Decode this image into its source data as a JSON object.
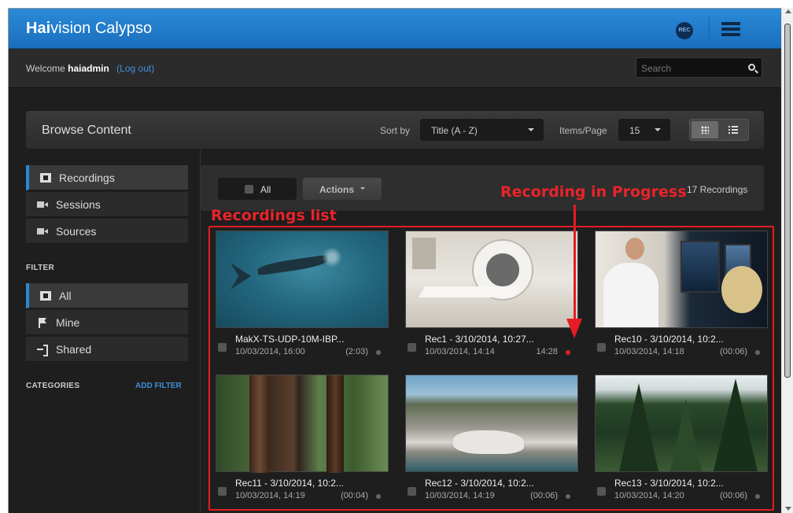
{
  "header": {
    "brand_bold": "Hai",
    "brand_rest": "vision Calypso",
    "rec_badge": "REC"
  },
  "welcome": {
    "prefix": "Welcome",
    "username": "haiadmin",
    "logout": "(Log out)"
  },
  "search": {
    "placeholder": "Search"
  },
  "browse": {
    "title": "Browse Content",
    "sort_label": "Sort by",
    "sort_value": "Title (A - Z)",
    "ipp_label": "Items/Page",
    "ipp_value": "15"
  },
  "sidebar": {
    "items": [
      {
        "label": "Recordings",
        "icon": "film-icon",
        "active": true
      },
      {
        "label": "Sessions",
        "icon": "camera-icon",
        "active": false
      },
      {
        "label": "Sources",
        "icon": "camera-icon",
        "active": false
      }
    ],
    "filter_heading": "FILTER",
    "filters": [
      {
        "label": "All",
        "icon": "film-icon",
        "active": true
      },
      {
        "label": "Mine",
        "icon": "flag-icon",
        "active": false
      },
      {
        "label": "Shared",
        "icon": "share-icon",
        "active": false
      }
    ],
    "categories_heading": "CATEGORIES",
    "add_filter": "ADD FILTER"
  },
  "content": {
    "all_label": "All",
    "actions_label": "Actions",
    "count_text": "17 Recordings"
  },
  "recordings": [
    {
      "title": "MakX-TS-UDP-10M-IBP...",
      "date": "10/03/2014, 16:00",
      "duration": "(2:03)",
      "live": false
    },
    {
      "title": "Rec1 - 3/10/2014, 10:27...",
      "date": "10/03/2014, 14:14",
      "duration": "14:28",
      "live": true
    },
    {
      "title": "Rec10 - 3/10/2014, 10:2...",
      "date": "10/03/2014, 14:18",
      "duration": "(00:06)",
      "live": false
    },
    {
      "title": "Rec11 - 3/10/2014, 10:2...",
      "date": "10/03/2014, 14:19",
      "duration": "(00:04)",
      "live": false
    },
    {
      "title": "Rec12 - 3/10/2014, 10:2...",
      "date": "10/03/2014, 14:19",
      "duration": "(00:06)",
      "live": false
    },
    {
      "title": "Rec13 - 3/10/2014, 10:2...",
      "date": "10/03/2014, 14:20",
      "duration": "(00:06)",
      "live": false
    }
  ],
  "annotations": {
    "list_label": "Recordings list",
    "progress_label": "Recording in Progress"
  },
  "colors": {
    "accent": "#2a88d6",
    "annotation": "#e51c23",
    "live_dot": "#e02020"
  }
}
